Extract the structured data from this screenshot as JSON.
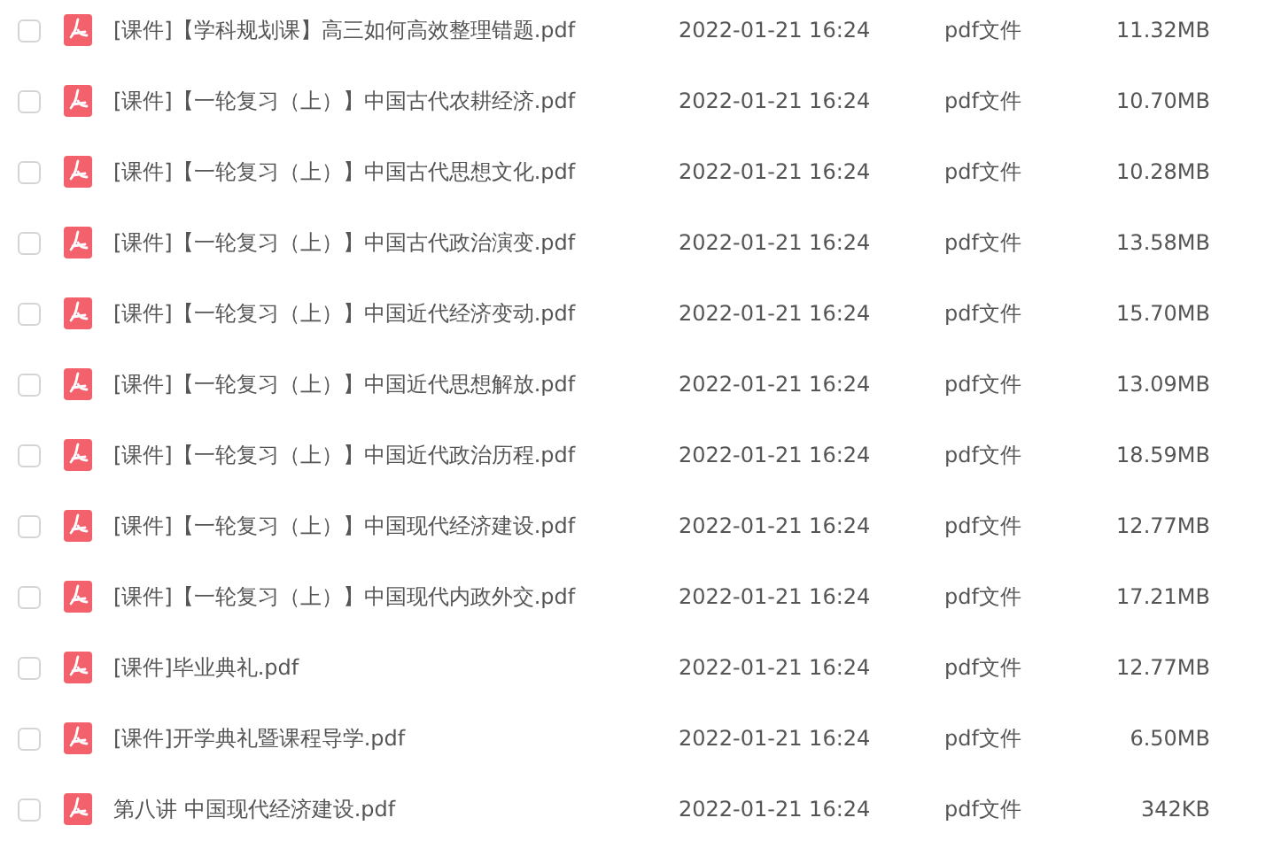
{
  "files": [
    {
      "checked": false,
      "name": "[课件]【学科规划课】高三如何高效整理错题.pdf",
      "date": "2022-01-21 16:24",
      "type": "pdf文件",
      "size": "11.32MB"
    },
    {
      "checked": false,
      "name": "[课件]【一轮复习（上）】中国古代农耕经济.pdf",
      "date": "2022-01-21 16:24",
      "type": "pdf文件",
      "size": "10.70MB"
    },
    {
      "checked": false,
      "name": "[课件]【一轮复习（上）】中国古代思想文化.pdf",
      "date": "2022-01-21 16:24",
      "type": "pdf文件",
      "size": "10.28MB"
    },
    {
      "checked": false,
      "name": "[课件]【一轮复习（上）】中国古代政治演变.pdf",
      "date": "2022-01-21 16:24",
      "type": "pdf文件",
      "size": "13.58MB"
    },
    {
      "checked": false,
      "name": "[课件]【一轮复习（上）】中国近代经济变动.pdf",
      "date": "2022-01-21 16:24",
      "type": "pdf文件",
      "size": "15.70MB"
    },
    {
      "checked": false,
      "name": "[课件]【一轮复习（上）】中国近代思想解放.pdf",
      "date": "2022-01-21 16:24",
      "type": "pdf文件",
      "size": "13.09MB"
    },
    {
      "checked": false,
      "name": "[课件]【一轮复习（上）】中国近代政治历程.pdf",
      "date": "2022-01-21 16:24",
      "type": "pdf文件",
      "size": "18.59MB"
    },
    {
      "checked": false,
      "name": "[课件]【一轮复习（上）】中国现代经济建设.pdf",
      "date": "2022-01-21 16:24",
      "type": "pdf文件",
      "size": "12.77MB"
    },
    {
      "checked": false,
      "name": "[课件]【一轮复习（上）】中国现代内政外交.pdf",
      "date": "2022-01-21 16:24",
      "type": "pdf文件",
      "size": "17.21MB"
    },
    {
      "checked": false,
      "name": "[课件]毕业典礼.pdf",
      "date": "2022-01-21 16:24",
      "type": "pdf文件",
      "size": "12.77MB"
    },
    {
      "checked": false,
      "name": "[课件]开学典礼暨课程导学.pdf",
      "date": "2022-01-21 16:24",
      "type": "pdf文件",
      "size": "6.50MB"
    },
    {
      "checked": false,
      "name": "第八讲 中国现代经济建设.pdf",
      "date": "2022-01-21 16:24",
      "type": "pdf文件",
      "size": "342KB"
    }
  ]
}
